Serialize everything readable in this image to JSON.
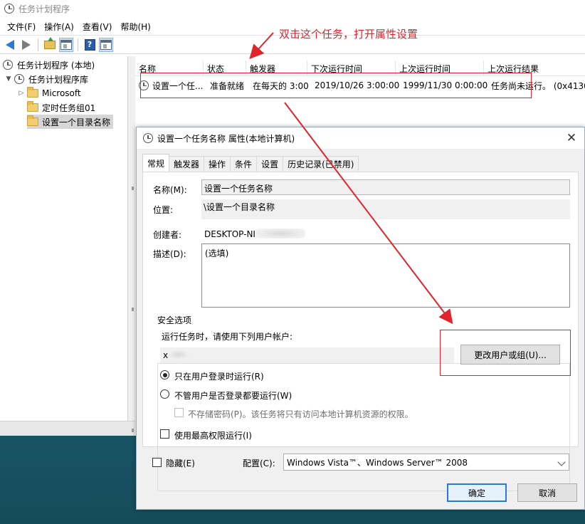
{
  "window": {
    "title": "任务计划程序"
  },
  "menu": [
    {
      "label": "文件(F)"
    },
    {
      "label": "操作(A)"
    },
    {
      "label": "查看(V)"
    },
    {
      "label": "帮助(H)"
    }
  ],
  "tree": {
    "root": "任务计划程序 (本地)",
    "library": "任务计划程序库",
    "children": [
      {
        "label": "Microsoft"
      },
      {
        "label": "定时任务组01"
      },
      {
        "label": "设置一个目录名称"
      }
    ]
  },
  "list": {
    "columns": [
      "名称",
      "状态",
      "触发器",
      "下次运行时间",
      "上次运行时间",
      "上次运行结果"
    ],
    "rows": [
      {
        "name": "设置一个任...",
        "status": "准备就绪",
        "trigger": "在每天的 3:00",
        "next_run": "2019/10/26 3:00:00",
        "last_run": "1999/11/30 0:00:00",
        "result": "任务尚未运行。 (0x4130"
      }
    ]
  },
  "annotation": {
    "text": "双击这个任务，打开属性设置"
  },
  "dialog": {
    "title": "设置一个任务名称 属性(本地计算机)",
    "tabs": [
      "常规",
      "触发器",
      "操作",
      "条件",
      "设置",
      "历史记录(已禁用)"
    ],
    "name_label": "名称(M):",
    "name_value": "设置一个任务名称",
    "location_label": "位置:",
    "location_value": "\\设置一个目录名称",
    "author_label": "创建者:",
    "author_value": "DESKTOP-NI",
    "description_label": "描述(D):",
    "description_value": "(选填)",
    "security_legend": "安全选项",
    "run_as_prompt": "运行任务时，请使用下列用户帐户:",
    "run_as_value": "x",
    "change_user_button": "更改用户或组(U)...",
    "radio_logged_on": "只在用户登录时运行(R)",
    "radio_any": "不管用户是否登录都要运行(W)",
    "no_store_password": "不存储密码(P)。该任务将只有访问本地计算机资源的权限。",
    "highest_privileges": "使用最高权限运行(I)",
    "hidden_label": "隐藏(E)",
    "configure_label": "配置(C):",
    "configure_value": "Windows Vista™、Windows Server™ 2008",
    "ok_button": "确定",
    "cancel_button": "取消"
  },
  "colors": {
    "annotation_red": "#e1242b",
    "accent_blue": "#2c79d4"
  }
}
